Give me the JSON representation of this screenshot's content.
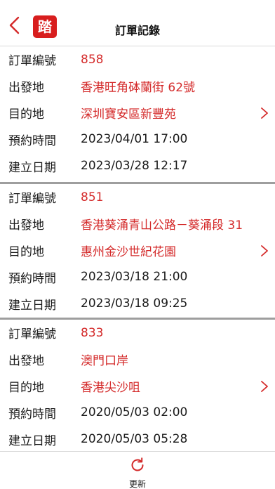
{
  "header": {
    "title": "訂單記錄",
    "logo_char": "踏",
    "back_icon": "chevron-left-icon",
    "accent_color": "#d81e1e"
  },
  "orders": [
    {
      "order_no_label": "訂單編號",
      "order_no": "858",
      "origin_label": "出發地",
      "origin": "香港旺角砵蘭街 62號",
      "destination_label": "目的地",
      "destination": "深圳寶安區新豐苑",
      "booking_time_label": "預約時間",
      "booking_time": "2023/04/01 17:00",
      "created_label": "建立日期",
      "created": "2023/03/28 12:17"
    },
    {
      "order_no_label": "訂單編號",
      "order_no": "851",
      "origin_label": "出發地",
      "origin": "香港葵涌青山公路－葵涌段 31",
      "destination_label": "目的地",
      "destination": "惠州金沙世紀花園",
      "booking_time_label": "預約時間",
      "booking_time": "2023/03/18 21:00",
      "created_label": "建立日期",
      "created": "2023/03/18 09:25"
    },
    {
      "order_no_label": "訂單編號",
      "order_no": "833",
      "origin_label": "出發地",
      "origin": "澳門口岸",
      "destination_label": "目的地",
      "destination": "香港尖沙咀",
      "booking_time_label": "預約時間",
      "booking_time": "2020/05/03 02:00",
      "created_label": "建立日期",
      "created": "2020/05/03 05:28"
    }
  ],
  "footer": {
    "refresh_label": "更新",
    "refresh_icon": "refresh-icon"
  }
}
